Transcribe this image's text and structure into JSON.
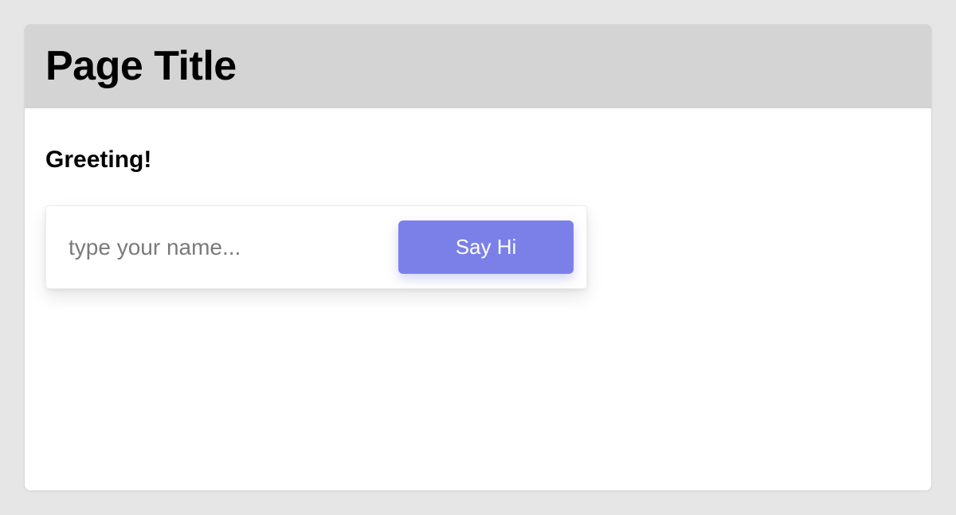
{
  "header": {
    "title": "Page Title"
  },
  "main": {
    "greeting_heading": "Greeting!",
    "name_input": {
      "value": "",
      "placeholder": "type your name..."
    },
    "say_hi_label": "Say Hi"
  }
}
